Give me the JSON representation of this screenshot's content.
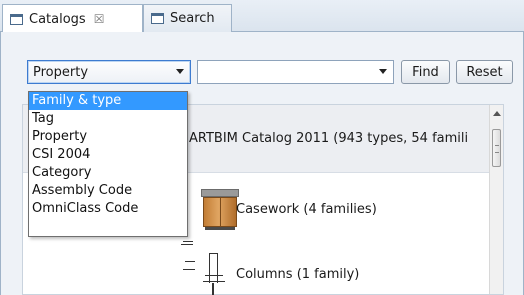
{
  "tabs": [
    {
      "label": "Catalogs",
      "close": "☒"
    },
    {
      "label": "Search"
    }
  ],
  "toolbar": {
    "property_combo_value": "Property",
    "value_combo_value": "",
    "find_label": "Find",
    "reset_label": "Reset"
  },
  "dropdown": {
    "items": [
      "Family & type",
      "Tag",
      "Property",
      "CSI 2004",
      "Category",
      "Assembly Code",
      "OmniClass Code"
    ],
    "selected_index": 0
  },
  "content": {
    "catalog_label": "ARTBIM Catalog 2011  (943 types, 54 famili",
    "items": [
      {
        "label": "Casework  (4 families)",
        "icon": "cabinet-icon"
      },
      {
        "label": "Columns  (1 family)",
        "icon": "column-icon"
      }
    ]
  },
  "colors": {
    "selection": "#3399ff",
    "panel": "#eef2f7",
    "border": "#9fb3c8"
  }
}
